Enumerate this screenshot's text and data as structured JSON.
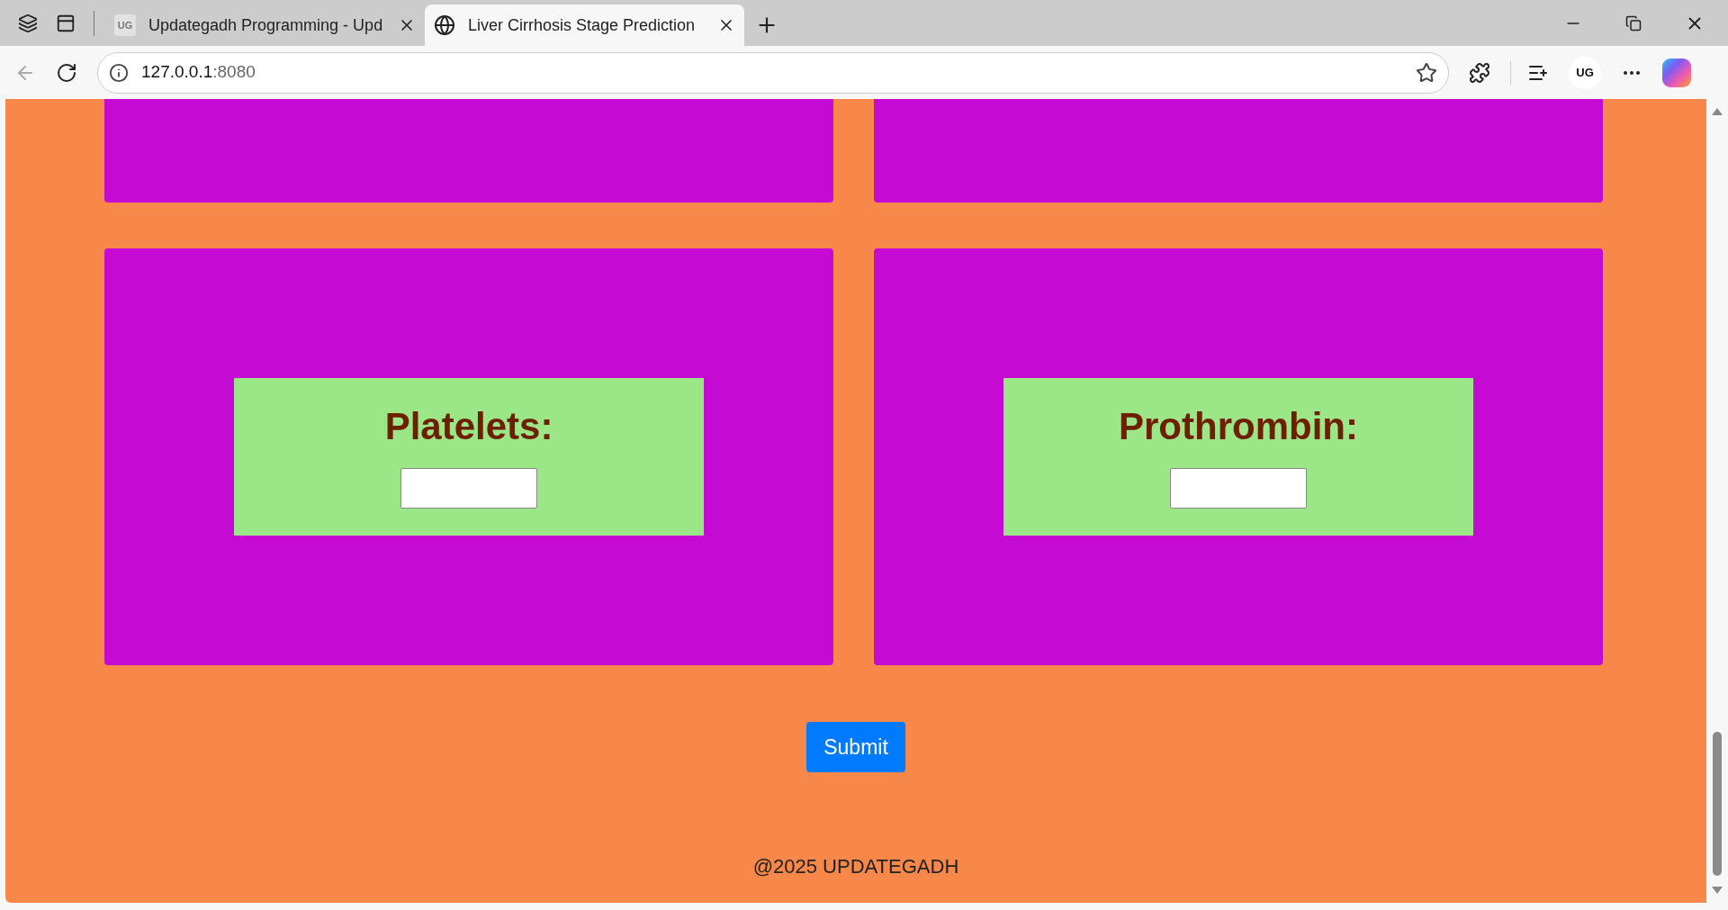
{
  "browser": {
    "tabs": [
      {
        "title": "Updategadh Programming - Upd",
        "kind": "logo",
        "logo_text": "UG",
        "selected": false
      },
      {
        "title": "Liver Cirrhosis Stage Prediction",
        "kind": "globe",
        "selected": true
      }
    ],
    "address": {
      "host": "127.0.0.1",
      "port": ":8080"
    },
    "profile": "UG"
  },
  "page": {
    "fields": [
      {
        "label": "Platelets:"
      },
      {
        "label": "Prothrombin:"
      }
    ],
    "submit": "Submit",
    "footer": "@2025 UPDATEGADH"
  }
}
